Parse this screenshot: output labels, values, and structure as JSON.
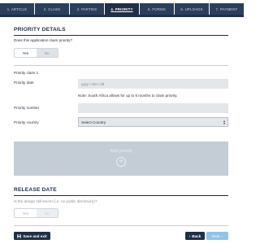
{
  "tabs": [
    {
      "label": "1. ARTICLE"
    },
    {
      "label": "2. CLASS"
    },
    {
      "label": "3. PARTIES"
    },
    {
      "label": "4. PRIORITY"
    },
    {
      "label": "5. FORMS"
    },
    {
      "label": "6. UPLOADS"
    },
    {
      "label": "7. PAYMENT"
    }
  ],
  "priority_details": {
    "title": "PRIORITY DETAILS",
    "question": "Does this application claim priority?",
    "yes_label": "Yes",
    "no_label": "No"
  },
  "priority_claim": {
    "heading": "Priority claim 1",
    "date_label": "Priority date",
    "date_placeholder": "yyyy / mm / dd",
    "note": "Note: South Africa allows for up to 6 months to claim priority.",
    "number_label": "Priority number",
    "number_value": "",
    "country_label": "Priority country",
    "country_value": "Select Country"
  },
  "add_priority": {
    "label": "Add priority"
  },
  "release_date": {
    "title": "RELEASE DATE",
    "question": "Is the design still secret (i.e. no public disclosure)?",
    "yes_label": "Yes",
    "no_label": "No"
  },
  "footer": {
    "save_label": "Save and exit",
    "back_label": "Back",
    "next_label": "Next"
  },
  "colors": {
    "navy": "#1f2f46",
    "tab_bg": "#2a3f5c",
    "field_bg": "#e4e7ea",
    "add_box_bg": "#c4ccd6",
    "next_button": "#8fc3ea"
  }
}
